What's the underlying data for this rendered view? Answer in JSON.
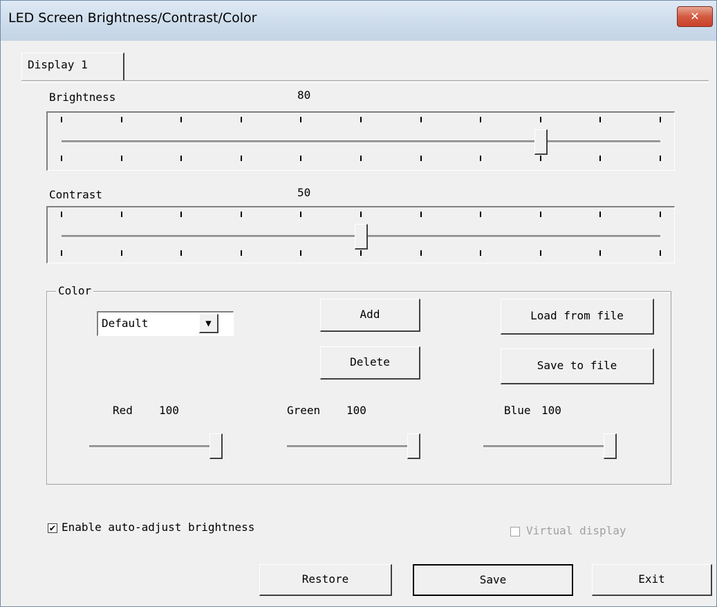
{
  "window": {
    "title": "LED Screen Brightness/Contrast/Color",
    "close_label": "✕"
  },
  "tab": {
    "label": "Display 1"
  },
  "brightness": {
    "label": "Brightness",
    "value": "80",
    "level": 80,
    "max": 100,
    "ticks": 11
  },
  "contrast": {
    "label": "Contrast",
    "value": "50",
    "level": 50,
    "max": 100,
    "ticks": 11
  },
  "color": {
    "group_label": "Color",
    "preset": {
      "value": "Default",
      "arrow": "▼"
    },
    "add_label": "Add",
    "delete_label": "Delete",
    "load_label": "Load from file",
    "save_file_label": "Save to file",
    "red": {
      "label": "Red",
      "value": "100",
      "level": 100
    },
    "green": {
      "label": "Green",
      "value": "100",
      "level": 100
    },
    "blue": {
      "label": "Blue",
      "value": "100",
      "level": 100
    }
  },
  "auto_adjust": {
    "label": "Enable auto-adjust brightness",
    "checked": true,
    "check_glyph": "✔"
  },
  "virtual_display": {
    "label": "Virtual display",
    "checked": false,
    "enabled": false
  },
  "buttons": {
    "restore": "Restore",
    "save": "Save",
    "exit": "Exit"
  }
}
